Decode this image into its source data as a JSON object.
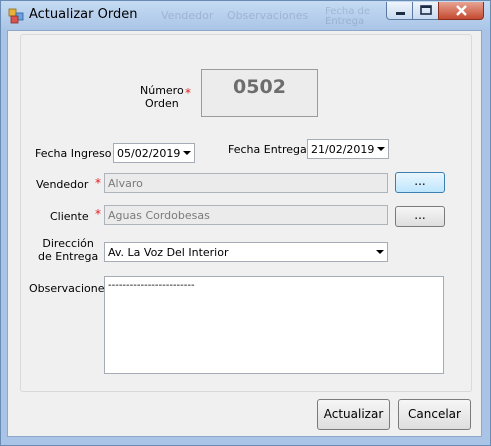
{
  "window": {
    "title": "Actualizar Orden",
    "ghost_columns": [
      "Vendedor",
      "Observaciones",
      "Fecha de Entrega"
    ]
  },
  "numero_orden": {
    "label": "Número\nOrden",
    "value": "0502"
  },
  "fecha_ingreso": {
    "label": "Fecha Ingreso",
    "value": "05/02/2019"
  },
  "fecha_entrega": {
    "label": "Fecha Entrega",
    "value": "21/02/2019"
  },
  "vendedor": {
    "label": "Vendedor",
    "value": "Alvaro",
    "browse_label": "..."
  },
  "cliente": {
    "label": "Cliente",
    "value": "Aguas Cordobesas",
    "browse_label": "..."
  },
  "direccion": {
    "label": "Dirección\nde Entrega",
    "value": "Av. La Voz Del Interior"
  },
  "observaciones": {
    "label": "Observaciones",
    "value": "------------------------"
  },
  "required_marker": "*",
  "buttons": {
    "actualizar": "Actualizar",
    "cancelar": "Cancelar"
  },
  "colors": {
    "required": "#e21c1c",
    "frame": "#a9c4e6",
    "client_bg": "#f0f0f0"
  },
  "icons": {
    "app": "window-app-icon",
    "minimize": "minimize-icon",
    "maximize": "maximize-icon",
    "close": "close-icon"
  }
}
